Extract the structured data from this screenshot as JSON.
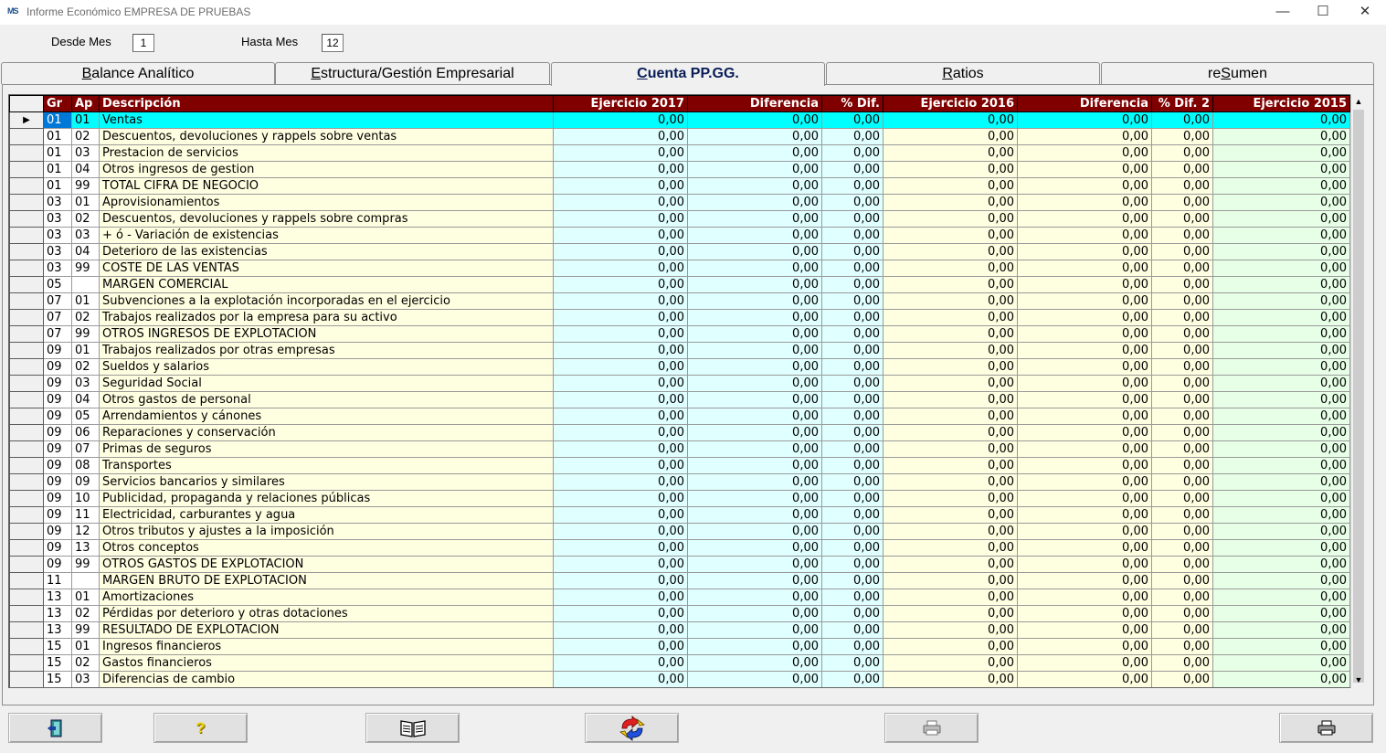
{
  "window": {
    "title": "Informe Económico EMPRESA DE PRUEBAS",
    "logo": "MS",
    "minimize": "—",
    "maximize": "☐",
    "close": "✕"
  },
  "filters": {
    "desde_label": "Desde Mes",
    "desde_value": "1",
    "hasta_label": "Hasta Mes",
    "hasta_value": "12"
  },
  "tabs": [
    {
      "pre": "",
      "u": "B",
      "post": "alance Analítico"
    },
    {
      "pre": "",
      "u": "E",
      "post": "structura/Gestión Empresarial"
    },
    {
      "pre": "",
      "u": "C",
      "post": "uenta PP.GG."
    },
    {
      "pre": "",
      "u": "R",
      "post": "atios"
    },
    {
      "pre": "re",
      "u": "S",
      "post": "umen"
    }
  ],
  "active_tab": 2,
  "grid": {
    "columns": [
      "Gr",
      "Ap",
      "Descripción",
      "Ejercicio 2017",
      "Diferencia",
      "% Dif.",
      "Ejercicio 2016",
      "Diferencia",
      "% Dif. 2",
      "Ejercicio 2015"
    ],
    "row_indicator": "▶",
    "rows": [
      [
        "01",
        "01",
        "Ventas",
        "0,00",
        "0,00",
        "0,00",
        "0,00",
        "0,00",
        "0,00",
        "0,00"
      ],
      [
        "01",
        "02",
        "Descuentos, devoluciones y rappels sobre ventas",
        "0,00",
        "0,00",
        "0,00",
        "0,00",
        "0,00",
        "0,00",
        "0,00"
      ],
      [
        "01",
        "03",
        "Prestacion de servicios",
        "0,00",
        "0,00",
        "0,00",
        "0,00",
        "0,00",
        "0,00",
        "0,00"
      ],
      [
        "01",
        "04",
        "Otros ingresos de gestion",
        "0,00",
        "0,00",
        "0,00",
        "0,00",
        "0,00",
        "0,00",
        "0,00"
      ],
      [
        "01",
        "99",
        "TOTAL CIFRA DE NEGOCIO",
        "0,00",
        "0,00",
        "0,00",
        "0,00",
        "0,00",
        "0,00",
        "0,00"
      ],
      [
        "03",
        "01",
        "Aprovisionamientos",
        "0,00",
        "0,00",
        "0,00",
        "0,00",
        "0,00",
        "0,00",
        "0,00"
      ],
      [
        "03",
        "02",
        "Descuentos, devoluciones y rappels sobre compras",
        "0,00",
        "0,00",
        "0,00",
        "0,00",
        "0,00",
        "0,00",
        "0,00"
      ],
      [
        "03",
        "03",
        "+ ó - Variación de existencias",
        "0,00",
        "0,00",
        "0,00",
        "0,00",
        "0,00",
        "0,00",
        "0,00"
      ],
      [
        "03",
        "04",
        "Deterioro de las existencias",
        "0,00",
        "0,00",
        "0,00",
        "0,00",
        "0,00",
        "0,00",
        "0,00"
      ],
      [
        "03",
        "99",
        "COSTE DE LAS VENTAS",
        "0,00",
        "0,00",
        "0,00",
        "0,00",
        "0,00",
        "0,00",
        "0,00"
      ],
      [
        "05",
        "",
        "MARGEN COMERCIAL",
        "0,00",
        "0,00",
        "0,00",
        "0,00",
        "0,00",
        "0,00",
        "0,00"
      ],
      [
        "07",
        "01",
        "Subvenciones a la explotación incorporadas en el ejercicio",
        "0,00",
        "0,00",
        "0,00",
        "0,00",
        "0,00",
        "0,00",
        "0,00"
      ],
      [
        "07",
        "02",
        "Trabajos realizados por la empresa para su activo",
        "0,00",
        "0,00",
        "0,00",
        "0,00",
        "0,00",
        "0,00",
        "0,00"
      ],
      [
        "07",
        "99",
        "OTROS INGRESOS DE EXPLOTACION",
        "0,00",
        "0,00",
        "0,00",
        "0,00",
        "0,00",
        "0,00",
        "0,00"
      ],
      [
        "09",
        "01",
        "Trabajos realizados por otras empresas",
        "0,00",
        "0,00",
        "0,00",
        "0,00",
        "0,00",
        "0,00",
        "0,00"
      ],
      [
        "09",
        "02",
        "Sueldos y salarios",
        "0,00",
        "0,00",
        "0,00",
        "0,00",
        "0,00",
        "0,00",
        "0,00"
      ],
      [
        "09",
        "03",
        "Seguridad Social",
        "0,00",
        "0,00",
        "0,00",
        "0,00",
        "0,00",
        "0,00",
        "0,00"
      ],
      [
        "09",
        "04",
        "Otros gastos de personal",
        "0,00",
        "0,00",
        "0,00",
        "0,00",
        "0,00",
        "0,00",
        "0,00"
      ],
      [
        "09",
        "05",
        "Arrendamientos y cánones",
        "0,00",
        "0,00",
        "0,00",
        "0,00",
        "0,00",
        "0,00",
        "0,00"
      ],
      [
        "09",
        "06",
        "Reparaciones y conservación",
        "0,00",
        "0,00",
        "0,00",
        "0,00",
        "0,00",
        "0,00",
        "0,00"
      ],
      [
        "09",
        "07",
        "Primas de seguros",
        "0,00",
        "0,00",
        "0,00",
        "0,00",
        "0,00",
        "0,00",
        "0,00"
      ],
      [
        "09",
        "08",
        "Transportes",
        "0,00",
        "0,00",
        "0,00",
        "0,00",
        "0,00",
        "0,00",
        "0,00"
      ],
      [
        "09",
        "09",
        "Servicios bancarios y similares",
        "0,00",
        "0,00",
        "0,00",
        "0,00",
        "0,00",
        "0,00",
        "0,00"
      ],
      [
        "09",
        "10",
        "Publicidad, propaganda y relaciones públicas",
        "0,00",
        "0,00",
        "0,00",
        "0,00",
        "0,00",
        "0,00",
        "0,00"
      ],
      [
        "09",
        "11",
        "Electricidad, carburantes y agua",
        "0,00",
        "0,00",
        "0,00",
        "0,00",
        "0,00",
        "0,00",
        "0,00"
      ],
      [
        "09",
        "12",
        "Otros tributos y ajustes a la imposición",
        "0,00",
        "0,00",
        "0,00",
        "0,00",
        "0,00",
        "0,00",
        "0,00"
      ],
      [
        "09",
        "13",
        "Otros conceptos",
        "0,00",
        "0,00",
        "0,00",
        "0,00",
        "0,00",
        "0,00",
        "0,00"
      ],
      [
        "09",
        "99",
        "OTROS GASTOS DE EXPLOTACION",
        "0,00",
        "0,00",
        "0,00",
        "0,00",
        "0,00",
        "0,00",
        "0,00"
      ],
      [
        "11",
        "",
        "MARGEN BRUTO DE EXPLOTACION",
        "0,00",
        "0,00",
        "0,00",
        "0,00",
        "0,00",
        "0,00",
        "0,00"
      ],
      [
        "13",
        "01",
        "Amortizaciones",
        "0,00",
        "0,00",
        "0,00",
        "0,00",
        "0,00",
        "0,00",
        "0,00"
      ],
      [
        "13",
        "02",
        "Pérdidas por deterioro y otras dotaciones",
        "0,00",
        "0,00",
        "0,00",
        "0,00",
        "0,00",
        "0,00",
        "0,00"
      ],
      [
        "13",
        "99",
        "RESULTADO DE EXPLOTACION",
        "0,00",
        "0,00",
        "0,00",
        "0,00",
        "0,00",
        "0,00",
        "0,00"
      ],
      [
        "15",
        "01",
        "Ingresos financieros",
        "0,00",
        "0,00",
        "0,00",
        "0,00",
        "0,00",
        "0,00",
        "0,00"
      ],
      [
        "15",
        "02",
        "Gastos financieros",
        "0,00",
        "0,00",
        "0,00",
        "0,00",
        "0,00",
        "0,00",
        "0,00"
      ],
      [
        "15",
        "03",
        "Diferencias de cambio",
        "0,00",
        "0,00",
        "0,00",
        "0,00",
        "0,00",
        "0,00",
        "0,00"
      ]
    ]
  },
  "scrollbar": {
    "up": "▲",
    "down": "▼"
  },
  "toolbar": {
    "help_glyph": "?",
    "buttons": [
      "exit-icon",
      "help-icon",
      "book-icon",
      "refresh-icon",
      "printer-preview-icon",
      "printer-icon"
    ]
  },
  "colors": {
    "header_bg": "#800000",
    "desc_bg": "#fefee0",
    "cyan_bg": "#e0ffff",
    "green_bg": "#e6ffe6",
    "selected_bg": "#00ffff",
    "active_tab_text": "#0a1d57"
  }
}
